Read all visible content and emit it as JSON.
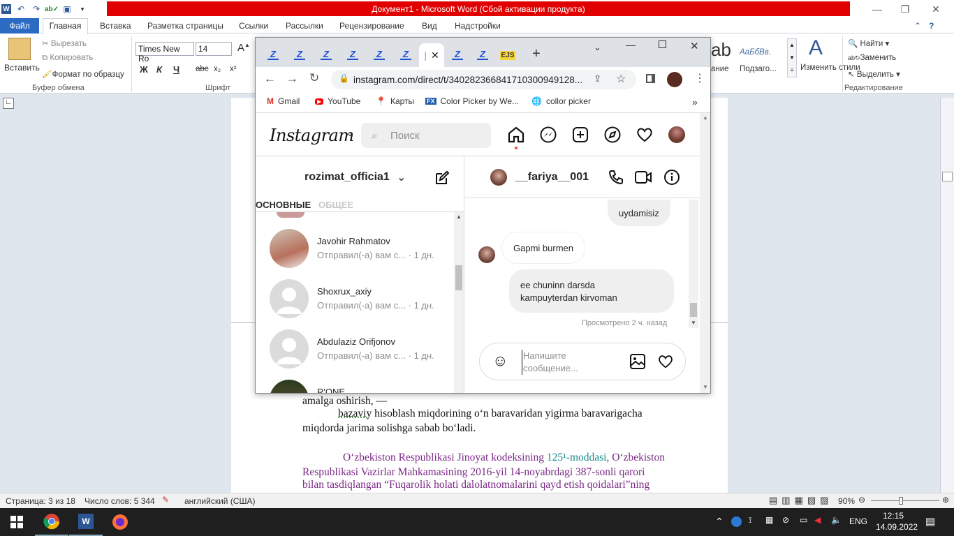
{
  "word": {
    "title": "Документ1  -  Microsoft Word (Сбой активации продукта)",
    "tabs": [
      "Файл",
      "Главная",
      "Вставка",
      "Разметка страницы",
      "Ссылки",
      "Рассылки",
      "Рецензирование",
      "Вид",
      "Надстройки"
    ],
    "clipboard": {
      "paste": "Вставить",
      "cut": "Вырезать",
      "copy": "Копировать",
      "format_painter": "Формат по образцу",
      "group": "Буфер обмена"
    },
    "font": {
      "name": "Times New Ro",
      "size": "14",
      "group": "Шрифт",
      "bold": "Ж",
      "italic": "К",
      "underline": "Ч",
      "strike": "abc",
      "sub": "x₂",
      "sup": "x²"
    },
    "styles": {
      "sample1": "ab",
      "sample2": "АаБбВв.",
      "heading": "ание",
      "subtitle": "Подзаго...",
      "change": "Изменить стили"
    },
    "editing": {
      "find": "Найти",
      "replace": "Заменить",
      "select": "Выделить",
      "group": "Редактирование"
    },
    "doc": {
      "line1": "amalga oshirish, —",
      "line2a": "bazaviy",
      "line2b": " hisoblash miqdorining o‘n baravaridan yigirma baravarigacha",
      "line3": "miqdorda jarima solishga sabab bo‘ladi.",
      "line4a": "O‘zbekiston Respublikasi Jinoyat kodeksining ",
      "line4b": "125¹-moddasi",
      "line4c": ", O‘zbekiston",
      "line5": "Respublikasi Vazirlar Mahkamasining 2016-yil 14-noyabrdagi 387-sonli qarori",
      "line6": "bilan tasdiqlangan “Fuqarolik holati dalolatnomalarini qayd etish qoidalari”ning"
    },
    "status": {
      "page": "Страница: 3 из 18",
      "words": "Число слов: 5 344",
      "lang": "английский (США)",
      "zoom": "90%"
    }
  },
  "taskbar": {
    "lang": "ENG",
    "time": "12:15",
    "date": "14.09.2022"
  },
  "chrome": {
    "url": "instagram.com/direct/t/340282366841710300949128...",
    "bookmarks": [
      "Gmail",
      "YouTube",
      "Карты",
      "Color Picker by We...",
      "collor picker"
    ],
    "ejs": "EJS"
  },
  "instagram": {
    "logo": "Instagram",
    "search_placeholder": "Поиск",
    "account": "rozimat_officia1",
    "tabs": {
      "primary": "ОСНОВНЫЕ",
      "general": "ОБЩЕЕ"
    },
    "threads": [
      {
        "name": "Javohir Rahmatov",
        "sub": "Отправил(-а) вам с... · 1 дн."
      },
      {
        "name": "Shoxrux_axiy",
        "sub": "Отправил(-а) вам с... · 1 дн."
      },
      {
        "name": "Abdulaziz Orifjonov",
        "sub": "Отправил(-а) вам с... · 1 дн."
      },
      {
        "name": "R'ONE",
        "sub": ""
      }
    ],
    "chat": {
      "user": "__fariya__001",
      "messages": [
        {
          "from": "me",
          "text": "uydamisiz"
        },
        {
          "from": "them",
          "text": "Gapmi burmen"
        },
        {
          "from": "me",
          "text": "ee chuninn darsda kampuyterdan kirvoman",
          "line1": "ee chuninn darsda",
          "line2": "kampuyterdan kirvoman"
        }
      ],
      "seen": "Просмотрено 2 ч. назад",
      "input_placeholder": "Напишите сообщение..."
    }
  }
}
